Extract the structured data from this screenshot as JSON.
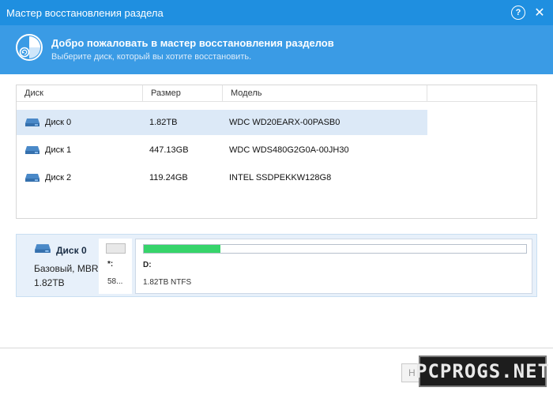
{
  "window": {
    "title": "Мастер восстановления раздела"
  },
  "header": {
    "title": "Добро пожаловать в мастер восстановления разделов",
    "subtitle": "Выберите диск, который вы хотите восстановить."
  },
  "table": {
    "columns": [
      "Диск",
      "Размер",
      "Модель"
    ],
    "rows": [
      {
        "disk": "Диск 0",
        "size": "1.82TB",
        "model": "WDC WD20EARX-00PASB0",
        "selected": true
      },
      {
        "disk": "Диск 1",
        "size": "447.13GB",
        "model": "WDC WDS480G2G0A-00JH30",
        "selected": false
      },
      {
        "disk": "Диск 2",
        "size": "119.24GB",
        "model": "INTEL SSDPEKKW128G8",
        "selected": false
      }
    ]
  },
  "disk_info": {
    "name": "Диск 0",
    "type": "Базовый, MBR",
    "size": "1.82TB",
    "partitions": [
      {
        "label": "*:",
        "size": "58...",
        "used_fraction": 0
      },
      {
        "label": "D:",
        "size": "1.82TB NTFS",
        "used_fraction": 0.2
      }
    ]
  },
  "buttons": {
    "next": "Н"
  },
  "watermark": {
    "text": "PCPROGS.NET"
  },
  "colors": {
    "titlebar": "#1f8fe0",
    "header": "#3a9be5",
    "selected_row": "#dce9f7",
    "usage_fill": "#36d46a",
    "disk_icon": "#4a89c8"
  },
  "icons": {
    "help": "help-icon",
    "close": "close-icon",
    "app": "partition-recovery-logo-icon",
    "disk": "hard-disk-icon"
  }
}
